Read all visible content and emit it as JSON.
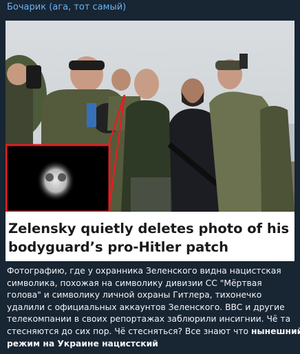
{
  "channel": {
    "sender_name": "Бочарик (ага, тот самый)",
    "name_color": "#6ab3f3"
  },
  "post": {
    "image": {
      "headline_lines": [
        "Zelensky quietly deletes photo of his",
        "bodyguard’s pro-Hitler patch"
      ],
      "zoom_frame_color": "#e02020"
    },
    "caption_lines": [
      "Фотографию, где у охранника Зеленского видна нацистская",
      "символика, похожая на символику дивизии СС \"Мёртвая",
      "голова\" и символику личной охраны Гитлера, тихонечко",
      "удалили с официальных аккаунтов Зеленского. BBC и другие",
      "телекомпании в своих репортажах заблюрили инсигнии. Чё та",
      "стесняются до сих пор. Чё стесняться? Все знают что "
    ],
    "caption_bold_inline": "нынешний",
    "caption_bold_last_line": "режим на Украине нацистский"
  }
}
